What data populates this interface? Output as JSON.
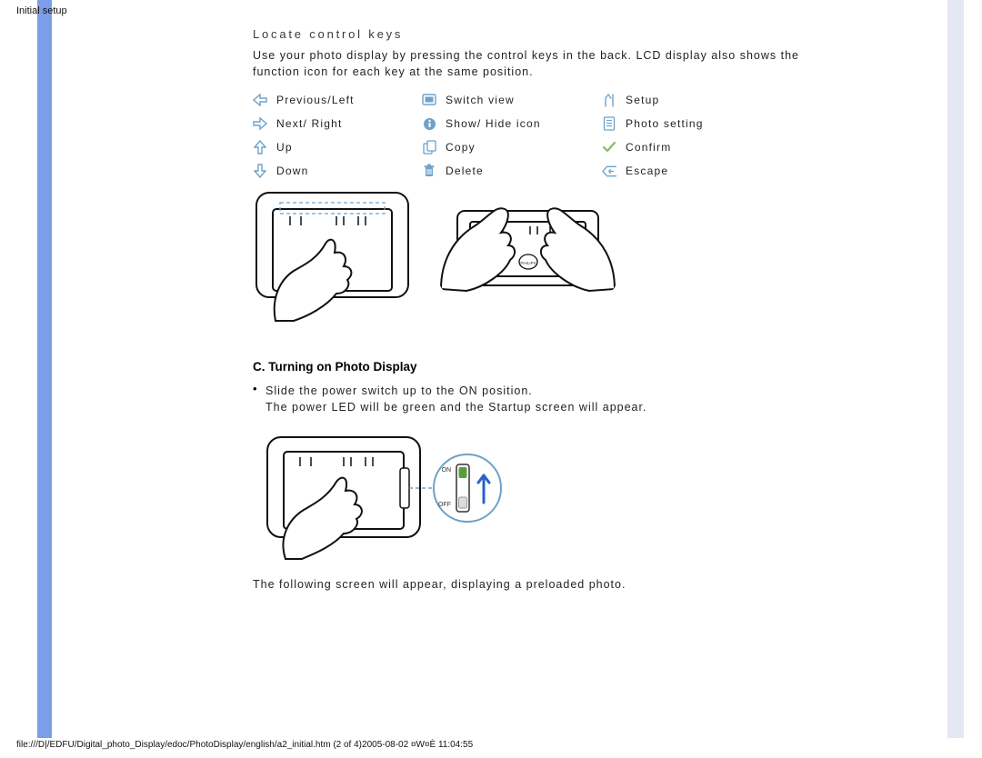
{
  "header": {
    "title": "Initial setup"
  },
  "footer": {
    "path": "file:///D|/EDFU/Digital_photo_Display/edoc/PhotoDisplay/english/a2_initial.htm (2 of 4)2005-08-02 ¤W¤È 11:04:55"
  },
  "locate": {
    "title": "Locate control keys",
    "intro": "Use your photo display by pressing the control keys in the back. LCD display also shows the function icon for each key at the same position.",
    "columns": [
      [
        {
          "icon": "arrow-left",
          "label": "Previous/Left"
        },
        {
          "icon": "arrow-right",
          "label": "Next/ Right"
        },
        {
          "icon": "arrow-up",
          "label": "Up"
        },
        {
          "icon": "arrow-down",
          "label": "Down"
        }
      ],
      [
        {
          "icon": "switch-view",
          "label": "Switch view"
        },
        {
          "icon": "info",
          "label": "Show/ Hide icon"
        },
        {
          "icon": "copy",
          "label": "Copy"
        },
        {
          "icon": "trash",
          "label": "Delete"
        }
      ],
      [
        {
          "icon": "setup",
          "label": "Setup"
        },
        {
          "icon": "photo-setting",
          "label": "Photo setting"
        },
        {
          "icon": "confirm",
          "label": "Confirm"
        },
        {
          "icon": "escape",
          "label": "Escape"
        }
      ]
    ]
  },
  "sectionC": {
    "heading": "C. Turning on Photo Display",
    "bullet_line1": "Slide the power switch up to the ON position.",
    "bullet_line2": "The power LED will be green and the Startup screen will appear.",
    "after_text": "The following screen will appear, displaying a preloaded photo.",
    "switch": {
      "on_label": "ON",
      "off_label": "OFF"
    }
  }
}
